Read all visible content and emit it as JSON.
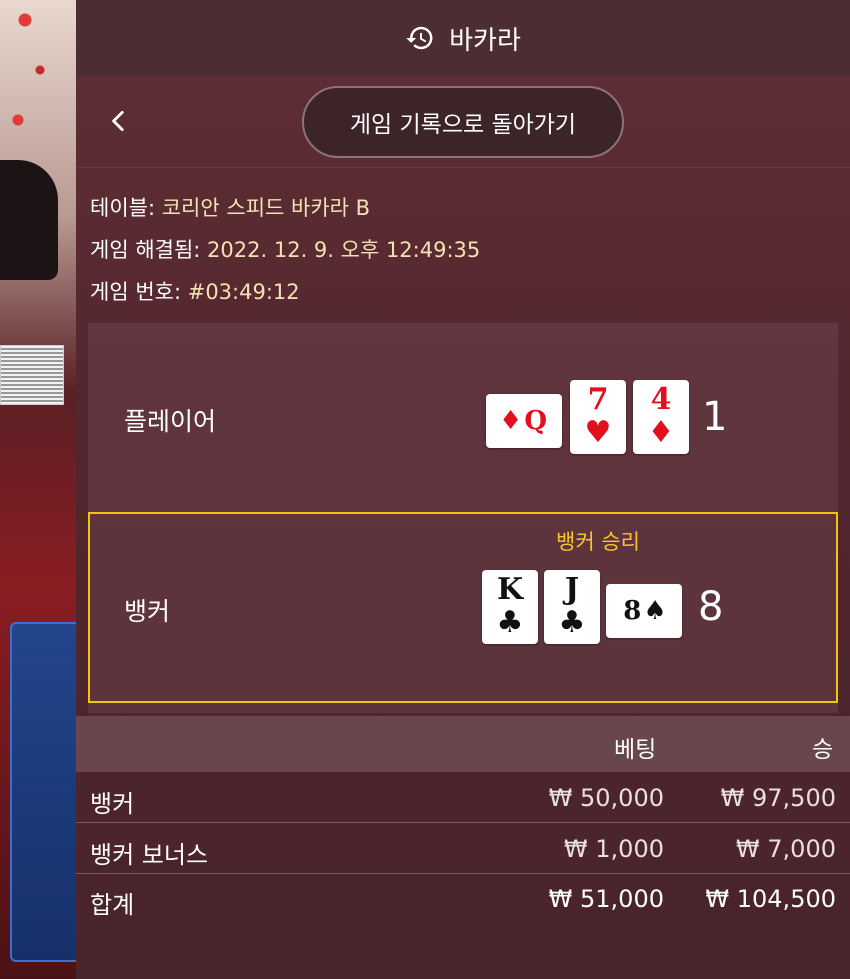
{
  "header": {
    "title": "바카라",
    "history_icon": "history-icon"
  },
  "nav": {
    "back_label": "게임 기록으로 돌아가기",
    "back_icon": "chevron-left-icon"
  },
  "info": {
    "table_label": "테이블:",
    "table_value": "코리안 스피드 바카라 B",
    "resolved_label": "게임 해결됨:",
    "resolved_value": "2022. 12. 9. 오후 12:49:35",
    "number_label": "게임 번호:",
    "number_value": "#03:49:12"
  },
  "player": {
    "label": "플레이어",
    "score": "1",
    "cards": [
      {
        "rank": "Q",
        "suit": "♦",
        "color": "red",
        "orientation": "side"
      },
      {
        "rank": "7",
        "suit": "♥",
        "color": "red",
        "orientation": "up"
      },
      {
        "rank": "4",
        "suit": "♦",
        "color": "red",
        "orientation": "up"
      }
    ]
  },
  "banker": {
    "label": "뱅커",
    "score": "8",
    "win_label": "뱅커 승리",
    "cards": [
      {
        "rank": "K",
        "suit": "♣",
        "color": "black",
        "orientation": "up"
      },
      {
        "rank": "J",
        "suit": "♣",
        "color": "black",
        "orientation": "up"
      },
      {
        "rank": "8",
        "suit": "♠",
        "color": "black",
        "orientation": "side"
      }
    ]
  },
  "bets": {
    "col_bet": "베팅",
    "col_win": "승",
    "rows": [
      {
        "name": "뱅커",
        "bet": "₩ 50,000",
        "win": "₩ 97,500"
      },
      {
        "name": "뱅커 보너스",
        "bet": "₩ 1,000",
        "win": "₩ 7,000"
      }
    ],
    "total": {
      "name": "합계",
      "bet": "₩ 51,000",
      "win": "₩ 104,500"
    }
  },
  "colors": {
    "winner_highlight": "#f1c40f",
    "info_value": "#f3e2b3",
    "red_suit": "#e0101c"
  }
}
